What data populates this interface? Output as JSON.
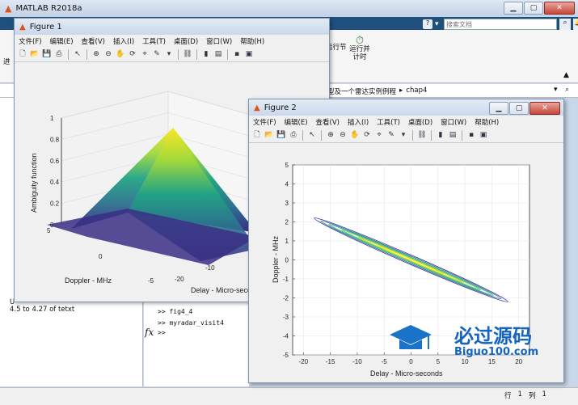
{
  "main": {
    "title": "MATLAB R2018a",
    "search_placeholder": "搜索文档",
    "ribbon": {
      "run_section": "运行节",
      "run_and_time_line1": "运行并",
      "run_and_time_line2": "计时",
      "advance": "进"
    },
    "path": {
      "segment1": "型及一个雷达实例例程",
      "separator": "▸",
      "segment2": "chap4"
    },
    "left_panel_text": "4.5 to 4.27 of tetxt",
    "left_fragment": "U",
    "command_history": [
      ">> fig4_4",
      ">> myradar_visit4",
      ">>"
    ],
    "fx_label": "fx",
    "status": {
      "row_label": "行",
      "row_value": "1",
      "col_label": "列",
      "col_value": "1"
    }
  },
  "figure1": {
    "title": "Figure 1",
    "menu": [
      "文件(F)",
      "编辑(E)",
      "查看(V)",
      "插入(I)",
      "工具(T)",
      "桌面(D)",
      "窗口(W)",
      "帮助(H)"
    ],
    "chart_data": {
      "type": "surface",
      "zlabel": "Ambiguity function",
      "xlabel": "Doppler - MHz",
      "ylabel": "Delay - Micro-seconds",
      "zticks": [
        "0",
        "0.2",
        "0.4",
        "0.6",
        "0.8",
        "1"
      ],
      "doppler_ticks": [
        "5",
        "0",
        "-5"
      ],
      "delay_ticks": [
        "-20",
        "-10"
      ],
      "peak": {
        "doppler": 0,
        "delay": 0,
        "value": 1
      }
    }
  },
  "figure2": {
    "title": "Figure 2",
    "menu": [
      "文件(F)",
      "编辑(E)",
      "查看(V)",
      "插入(I)",
      "工具(T)",
      "桌面(D)",
      "窗口(W)",
      "帮助(H)"
    ],
    "chart_data": {
      "type": "contour",
      "xlabel": "Delay - Micro-seconds",
      "ylabel": "Doppler - MHz",
      "xlim": [
        -22,
        22
      ],
      "ylim": [
        -5,
        5
      ],
      "xticks": [
        -20,
        -15,
        -10,
        -5,
        0,
        5,
        10,
        15,
        20
      ],
      "yticks": [
        5,
        4,
        3,
        2,
        1,
        0,
        -1,
        -2,
        -3,
        -4,
        -5
      ],
      "ridge": {
        "start": [
          -18,
          2.2
        ],
        "end": [
          18,
          -2.2
        ]
      }
    }
  },
  "watermark": {
    "brand": "必过源码",
    "site": "Biguo100.com"
  }
}
